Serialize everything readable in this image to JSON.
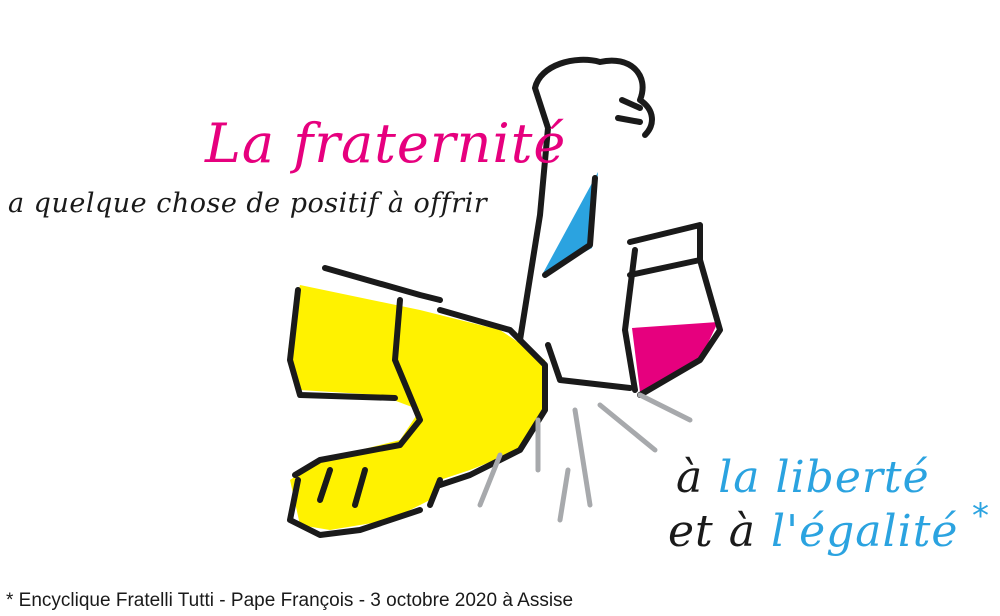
{
  "headline": "La fraternité",
  "subline": "a quelque chose de positif à offrir",
  "line1": {
    "prefix": "à ",
    "emph": "la liberté"
  },
  "line2": {
    "prefix": "et à ",
    "emph": "l'égalité"
  },
  "asterisk": "*",
  "footnote": "* Encyclique Fratelli Tutti - Pape François - 3 octobre 2020 à Assise",
  "colors": {
    "magenta": "#e6007e",
    "blue": "#2ba3e0",
    "yellow": "#fff200",
    "ink": "#1a1a1a",
    "gray": "#a7a9ac"
  },
  "illustration": {
    "name": "elbow-bump-illustration",
    "description_icons": [
      "fist-icon",
      "arm-yellow-icon",
      "impact-lines-icon"
    ]
  }
}
